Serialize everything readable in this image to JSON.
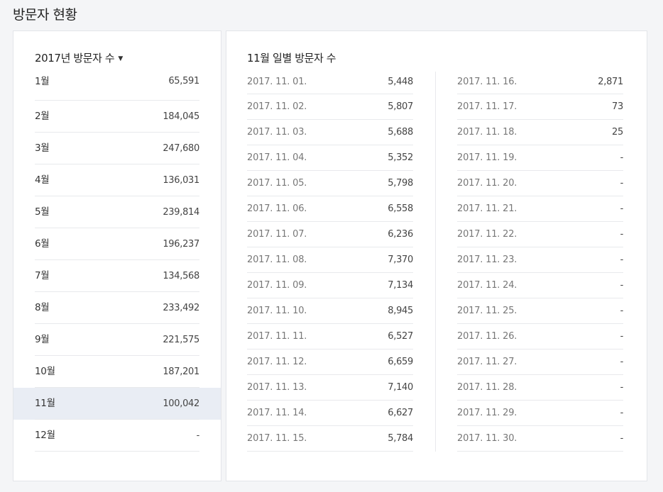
{
  "page_title": "방문자 현황",
  "yearly": {
    "header": "2017년 방문자 수",
    "caret_icon": "caret-down-icon",
    "selected_index": 10,
    "months": [
      {
        "label": "1월",
        "value": "65,591"
      },
      {
        "label": "2월",
        "value": "184,045"
      },
      {
        "label": "3월",
        "value": "247,680"
      },
      {
        "label": "4월",
        "value": "136,031"
      },
      {
        "label": "5월",
        "value": "239,814"
      },
      {
        "label": "6월",
        "value": "196,237"
      },
      {
        "label": "7월",
        "value": "134,568"
      },
      {
        "label": "8월",
        "value": "233,492"
      },
      {
        "label": "9월",
        "value": "221,575"
      },
      {
        "label": "10월",
        "value": "187,201"
      },
      {
        "label": "11월",
        "value": "100,042"
      },
      {
        "label": "12월",
        "value": "-"
      }
    ]
  },
  "daily": {
    "header": "11월 일별 방문자 수",
    "days": [
      {
        "date": "2017. 11. 01.",
        "value": "5,448"
      },
      {
        "date": "2017. 11. 02.",
        "value": "5,807"
      },
      {
        "date": "2017. 11. 03.",
        "value": "5,688"
      },
      {
        "date": "2017. 11. 04.",
        "value": "5,352"
      },
      {
        "date": "2017. 11. 05.",
        "value": "5,798"
      },
      {
        "date": "2017. 11. 06.",
        "value": "6,558"
      },
      {
        "date": "2017. 11. 07.",
        "value": "6,236"
      },
      {
        "date": "2017. 11. 08.",
        "value": "7,370"
      },
      {
        "date": "2017. 11. 09.",
        "value": "7,134"
      },
      {
        "date": "2017. 11. 10.",
        "value": "8,945"
      },
      {
        "date": "2017. 11. 11.",
        "value": "6,527"
      },
      {
        "date": "2017. 11. 12.",
        "value": "6,659"
      },
      {
        "date": "2017. 11. 13.",
        "value": "7,140"
      },
      {
        "date": "2017. 11. 14.",
        "value": "6,627"
      },
      {
        "date": "2017. 11. 15.",
        "value": "5,784"
      },
      {
        "date": "2017. 11. 16.",
        "value": "2,871"
      },
      {
        "date": "2017. 11. 17.",
        "value": "73"
      },
      {
        "date": "2017. 11. 18.",
        "value": "25"
      },
      {
        "date": "2017. 11. 19.",
        "value": "-"
      },
      {
        "date": "2017. 11. 20.",
        "value": "-"
      },
      {
        "date": "2017. 11. 21.",
        "value": "-"
      },
      {
        "date": "2017. 11. 22.",
        "value": "-"
      },
      {
        "date": "2017. 11. 23.",
        "value": "-"
      },
      {
        "date": "2017. 11. 24.",
        "value": "-"
      },
      {
        "date": "2017. 11. 25.",
        "value": "-"
      },
      {
        "date": "2017. 11. 26.",
        "value": "-"
      },
      {
        "date": "2017. 11. 27.",
        "value": "-"
      },
      {
        "date": "2017. 11. 28.",
        "value": "-"
      },
      {
        "date": "2017. 11. 29.",
        "value": "-"
      },
      {
        "date": "2017. 11. 30.",
        "value": "-"
      }
    ]
  },
  "colors": {
    "background": "#f4f5f7",
    "panel": "#ffffff",
    "selected_row": "#e9edf4",
    "divider": "#e8e9ec"
  }
}
